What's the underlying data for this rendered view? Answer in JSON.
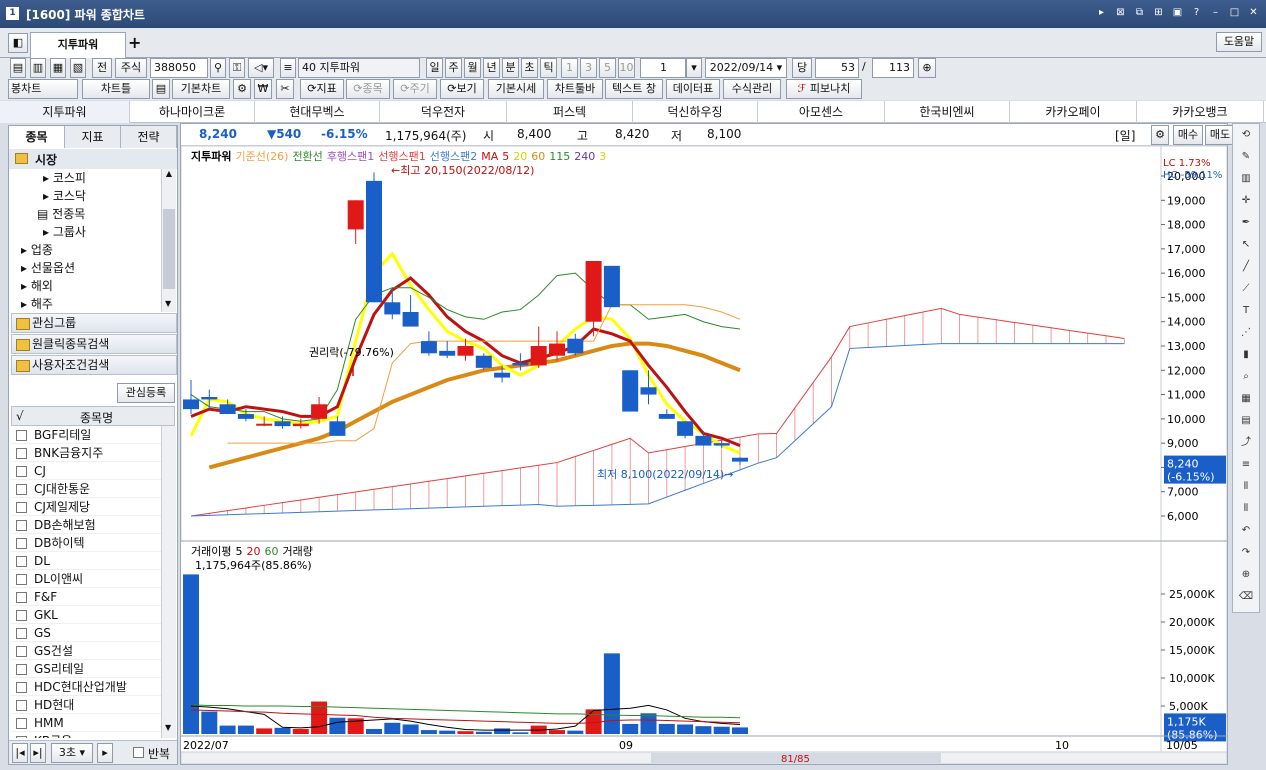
{
  "window": {
    "title": "[1600] 파워 종합차트",
    "icon": "1"
  },
  "tabs": {
    "active": "지투파워",
    "add": "+",
    "help": "도움말"
  },
  "toolbar1": {
    "front": "전",
    "type": "주식",
    "code": "388050",
    "num": "40",
    "name": "지투파워",
    "periods": [
      "일",
      "주",
      "월",
      "년",
      "분",
      "초",
      "틱"
    ],
    "nums": [
      "1",
      "3",
      "5",
      "10"
    ],
    "count": "1",
    "date": "2022/09/14",
    "dang": "당",
    "view": "53",
    "slash": "/",
    "total": "113"
  },
  "toolbar2": {
    "b1": "봉차트",
    "b2": "차트틀",
    "b3": "기본차트",
    "b4": "지표",
    "b5": "종목",
    "b6": "주기",
    "b7": "보기",
    "b8": "기본시세",
    "b9": "차트툴바",
    "b10": "텍스트 창",
    "b11": "데이터표",
    "b12": "수식관리",
    "b13": "피보나치"
  },
  "stocks": [
    "지투파워",
    "하나마이크론",
    "현대무벡스",
    "덕우전자",
    "퍼스텍",
    "덕신하우징",
    "아모센스",
    "한국비엔씨",
    "카카오페이",
    "카카오뱅크"
  ],
  "left": {
    "tabs": [
      "종목",
      "지표",
      "전략"
    ],
    "tree": [
      "시장",
      "코스피",
      "코스닥",
      "전종목",
      "그룹사",
      "업종",
      "선물옵션",
      "해외",
      "해주"
    ],
    "groups": [
      "관심그룹",
      "원클릭종목검색",
      "사용자조건검색"
    ],
    "register": "관심등록",
    "col_check": "√",
    "col_name": "종목명",
    "items": [
      "BGF리테일",
      "BNK금융지주",
      "CJ",
      "CJ대한통운",
      "CJ제일제당",
      "DB손해보험",
      "DB하이텍",
      "DL",
      "DL이앤씨",
      "F&F",
      "GKL",
      "GS",
      "GS건설",
      "GS리테일",
      "HDC현대산업개발",
      "HD현대",
      "HMM",
      "KB금융"
    ],
    "interval": "3초",
    "repeat": "반복"
  },
  "price": {
    "cur": "8,240",
    "chg": "▼540",
    "pct": "-6.15%",
    "vol": "1,175,964(주)",
    "open_l": "시",
    "open": "8,400",
    "high_l": "고",
    "high": "8,420",
    "low_l": "저",
    "low": "8,100",
    "period": "[일]",
    "buy": "매수",
    "sell": "매도"
  },
  "legend": {
    "name": "지투파워",
    "kijun": "기준선(26)",
    "tenkan": "전환선",
    "lag": "후행스팬1",
    "lead1": "선행스팬1",
    "lead2": "선행스팬2",
    "ma": "MA",
    "ma_vals": [
      "5",
      "20",
      "60",
      "115",
      "240",
      "3"
    ]
  },
  "annotations": {
    "high": "←최고 20,150(2022/08/12)",
    "low": "최저 8,100(2022/09/14)→",
    "rights": "권리락(-79.76%)",
    "lc": "LC   1.73%",
    "hc": "HC -59.11%",
    "cur_tag1": "8,240",
    "cur_tag2": "(-6.15%)"
  },
  "yaxis": [
    "20,000",
    "19,000",
    "18,000",
    "17,000",
    "16,000",
    "15,000",
    "14,000",
    "13,000",
    "12,000",
    "11,000",
    "10,000",
    "9,000",
    "8,000",
    "7,000",
    "6,000"
  ],
  "vol_legend": {
    "avg": "거래이평",
    "v1": "5",
    "v2": "20",
    "v3": "60",
    "name": "거래량",
    "last": "1,175,964주(85.86%)"
  },
  "vol_yaxis": [
    "25,000K",
    "20,000K",
    "15,000K",
    "10,000K",
    "5,000K"
  ],
  "vol_tag": {
    "a": "1,175K",
    "b": "(85.86%)"
  },
  "xaxis": [
    "2022/07",
    "09",
    "10",
    "10/05"
  ],
  "scroll": {
    "pos": "81/85"
  },
  "colors": {
    "up": "#e01818",
    "down": "#1a5fc8",
    "ma5": "#c01010",
    "ma20": "#ffff00",
    "ma60": "#d98a14"
  },
  "chart_data": {
    "type": "candlestick",
    "ylim": [
      6000,
      20000
    ],
    "candles_ohlc": [
      [
        10800,
        11600,
        10200,
        10400
      ],
      [
        10900,
        11200,
        10400,
        10800
      ],
      [
        10600,
        10800,
        10200,
        10200
      ],
      [
        10200,
        10400,
        9900,
        10000
      ],
      [
        9800,
        10100,
        9700,
        9800
      ],
      [
        9900,
        10100,
        9600,
        9700
      ],
      [
        9700,
        10000,
        9600,
        9800
      ],
      [
        10000,
        10900,
        9800,
        10600
      ],
      [
        9900,
        10100,
        9300,
        9300
      ],
      [
        17800,
        19000,
        17200,
        19000
      ],
      [
        19800,
        20150,
        14800,
        14800
      ],
      [
        14800,
        15400,
        14100,
        14300
      ],
      [
        14400,
        15100,
        13800,
        13800
      ],
      [
        13200,
        13600,
        12600,
        12700
      ],
      [
        12800,
        13200,
        12500,
        12600
      ],
      [
        12600,
        13300,
        12400,
        13000
      ],
      [
        12600,
        12700,
        12000,
        12100
      ],
      [
        11900,
        12200,
        11500,
        11700
      ],
      [
        12300,
        12700,
        12000,
        12200
      ],
      [
        12200,
        13800,
        12100,
        13000
      ],
      [
        12600,
        13600,
        12400,
        13100
      ],
      [
        13300,
        13500,
        12600,
        12700
      ],
      [
        14000,
        16500,
        13400,
        16500
      ],
      [
        16300,
        16300,
        14600,
        14600
      ],
      [
        12000,
        12000,
        10300,
        10300
      ],
      [
        11300,
        12000,
        10600,
        11000
      ],
      [
        10200,
        10400,
        10000,
        10000
      ],
      [
        9900,
        9900,
        9200,
        9300
      ],
      [
        9300,
        9500,
        8900,
        8900
      ],
      [
        9000,
        9100,
        8800,
        8900
      ],
      [
        8400,
        8420,
        8100,
        8240
      ]
    ],
    "volume_k": [
      28500,
      4000,
      1500,
      1500,
      1000,
      1100,
      900,
      5800,
      2900,
      2800,
      900,
      2000,
      1700,
      700,
      600,
      500,
      400,
      1000,
      300,
      1500,
      700,
      600,
      4400,
      14400,
      1800,
      3700,
      1800,
      1700,
      1400,
      1300,
      1176
    ]
  }
}
